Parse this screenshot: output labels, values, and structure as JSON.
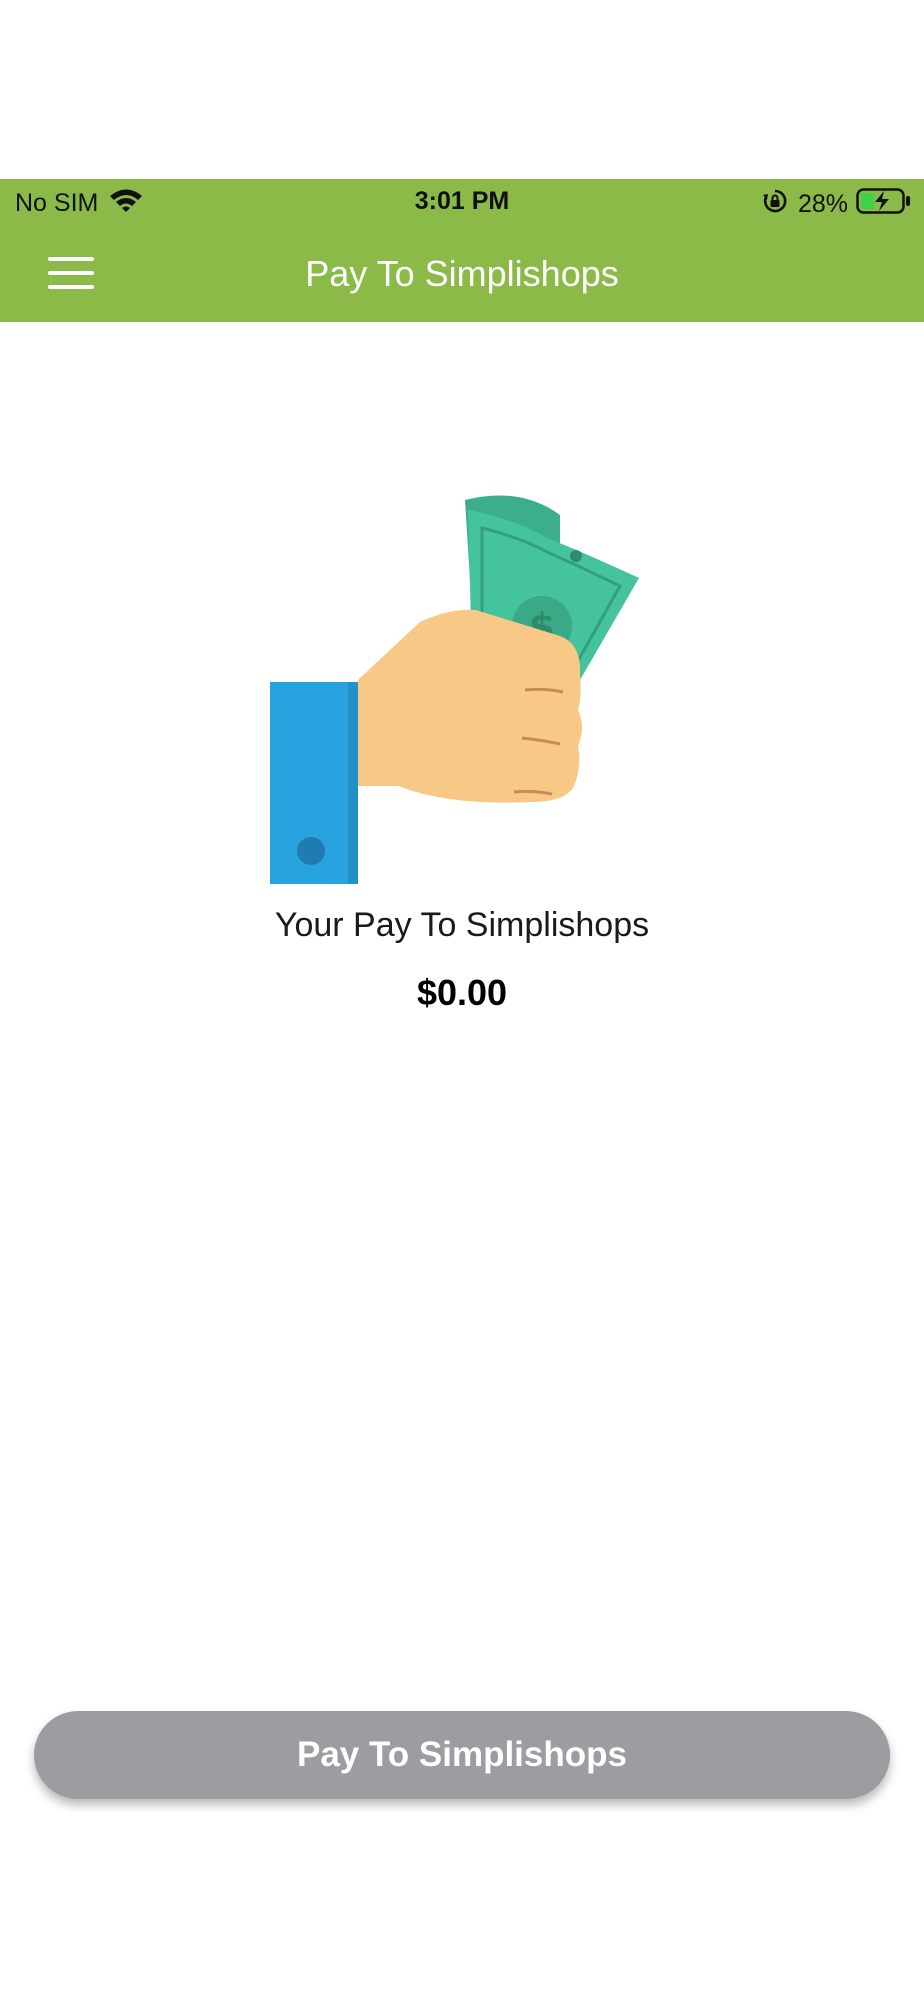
{
  "status_bar": {
    "carrier": "No SIM",
    "time": "3:01 PM",
    "battery_percent": "28%",
    "wifi_icon": "wifi-icon",
    "orientation_lock_icon": "orientation-lock-icon",
    "battery_icon": "battery-charging-icon"
  },
  "header": {
    "title": "Pay To Simplishops",
    "menu_icon": "hamburger-menu-icon",
    "background_color": "#8bba49"
  },
  "main": {
    "illustration": "hand-holding-money-icon",
    "label": "Your Pay To Simplishops",
    "amount": "$0.00"
  },
  "footer": {
    "pay_button_label": "Pay To Simplishops",
    "pay_button_color": "#9d9ca1"
  }
}
